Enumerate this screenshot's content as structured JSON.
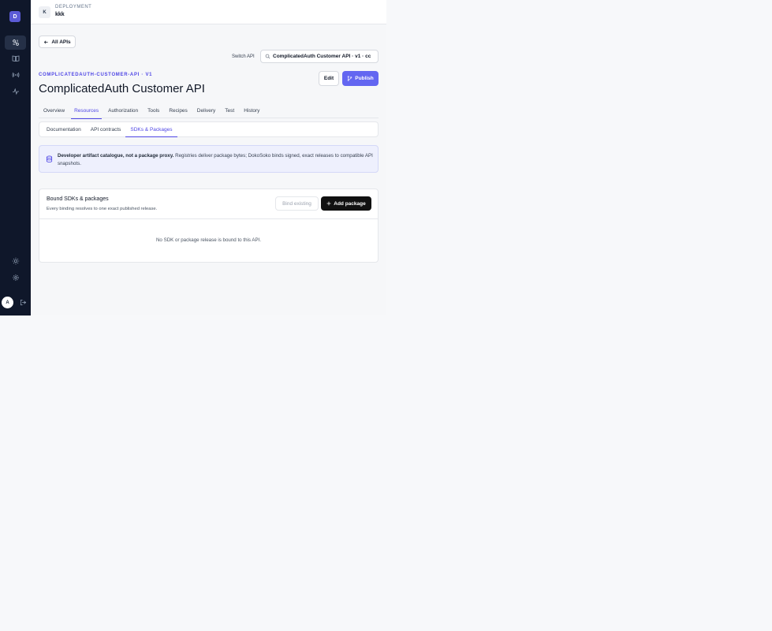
{
  "colors": {
    "sidebar_bg": "#0f172a",
    "accent": "#6366f1",
    "accent_text": "#4f46e5",
    "banner_bg": "#eef0fd",
    "dark_button": "#111111"
  },
  "sidebar": {
    "logo_letter": "D",
    "nav_icons": [
      "apis-icon",
      "book-icon",
      "broadcast-icon",
      "activity-icon"
    ],
    "bottom_icons": [
      "sun-icon",
      "gear-icon",
      "logout-icon"
    ],
    "avatar_letter": "A"
  },
  "topbar": {
    "workspace_badge": "K",
    "kicker": "DEPLOYMENT",
    "name": "kkk"
  },
  "header": {
    "back_label": "All APIs",
    "switch_label": "Switch API",
    "switch_value": "ComplicatedAuth Customer API · v1 · cc",
    "slug": "COMPLICATEDAUTH-CUSTOMER-API · V1",
    "title": "ComplicatedAuth Customer API",
    "edit_label": "Edit",
    "publish_label": "Publish"
  },
  "tabs": [
    {
      "label": "Overview",
      "active": false
    },
    {
      "label": "Resources",
      "active": true
    },
    {
      "label": "Authorization",
      "active": false
    },
    {
      "label": "Tools",
      "active": false
    },
    {
      "label": "Recipes",
      "active": false
    },
    {
      "label": "Delivery",
      "active": false
    },
    {
      "label": "Test",
      "active": false
    },
    {
      "label": "History",
      "active": false
    }
  ],
  "subtabs": [
    {
      "label": "Documentation",
      "active": false
    },
    {
      "label": "API contracts",
      "active": false
    },
    {
      "label": "SDKs & Packages",
      "active": true
    }
  ],
  "banner": {
    "bold": "Developer artifact catalogue, not a package proxy.",
    "text": " Registries deliver package bytes; DokoSoko binds signed, exact releases to compatible API snapshots."
  },
  "card": {
    "title": "Bound SDKs & packages",
    "subtitle": "Every binding resolves to one exact published release.",
    "bind_existing_label": "Bind existing",
    "add_package_label": "Add package",
    "empty_text": "No SDK or package release is bound to this API."
  }
}
